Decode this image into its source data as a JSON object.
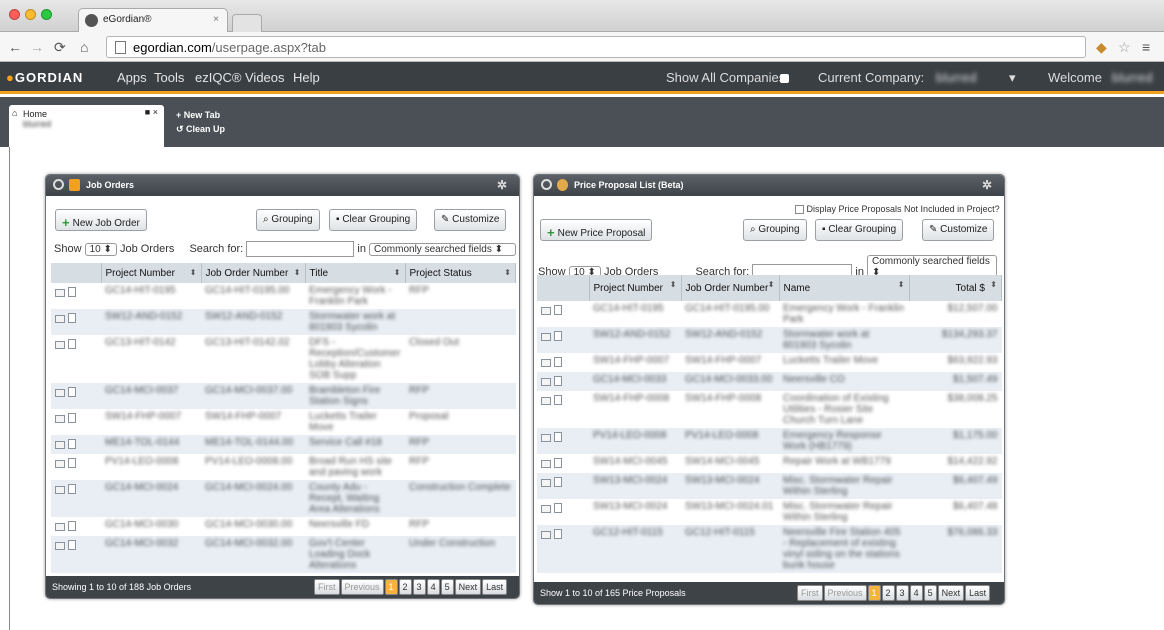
{
  "browser": {
    "tab_title": "eGordian®",
    "url_domain": "egordian.com",
    "url_path": "/userpage.aspx?tab"
  },
  "app": {
    "logo": "GORDIAN",
    "menu": [
      "Apps",
      "Tools",
      "ezIQC®",
      "Videos",
      "Help"
    ],
    "show_all_companies": "Show All Companies",
    "current_company_label": "Current Company:",
    "current_company_value": "blurred",
    "welcome": "Welcome",
    "welcome_user": "blurred"
  },
  "workspace": {
    "home_tab": "Home",
    "home_sub": "blurred",
    "new_tab": "New Tab",
    "clean_up": "Clean Up"
  },
  "job_orders": {
    "title": "Job Orders",
    "new_button": "New Job Order",
    "grouping": "Grouping",
    "clear_grouping": "Clear Grouping",
    "customize": "Customize",
    "show_label": "Show",
    "show_value": "10",
    "show_suffix": "Job Orders",
    "search_label": "Search for:",
    "in_label": "in",
    "search_scope": "Commonly searched fields",
    "columns": [
      "Project Number",
      "Job Order Number",
      "Title",
      "Project Status"
    ],
    "rows": [
      [
        "GC14-HIT-0195",
        "GC14-HIT-0195.00",
        "Emergency Work - Franklin Park",
        "RFP"
      ],
      [
        "SW12-AND-0152",
        "SW12-AND-0152",
        "Stormwater work at 801903 Sycolin",
        ""
      ],
      [
        "GC13-HIT-0142",
        "GC13-HIT-0142.02",
        "DFS - Reception/Customer Lobby Alteration SOB Supp",
        "Closed Out"
      ],
      [
        "GC14-MCI-0037",
        "GC14-MCI-0037.00",
        "Brambleton Fire Station Signs",
        "RFP"
      ],
      [
        "SW14-FHP-0007",
        "SW14-FHP-0007",
        "Lucketts Trailer Move",
        "Proposal"
      ],
      [
        "ME14-TOL-0144",
        "ME14-TOL-0144.00",
        "Service Call #18",
        "RFP"
      ],
      [
        "PV14-LEO-0008",
        "PV14-LEO-0008.00",
        "Broad Run HS site and paving work",
        "RFP"
      ],
      [
        "GC14-MCI-0024",
        "GC14-MCI-0024.00",
        "County Adu - Recept, Waiting Area Alterations",
        "Construction Complete"
      ],
      [
        "GC14-MCI-0030",
        "GC14-MCI-0030.00",
        "Neersville FD",
        "RFP"
      ],
      [
        "GC14-MCI-0032",
        "GC14-MCI-0032.00",
        "Gov't Center Loading Dock Alterations",
        "Under Construction"
      ]
    ],
    "footer": "Showing 1 to 10 of 188 Job Orders",
    "pager": [
      "First",
      "Previous",
      "1",
      "2",
      "3",
      "4",
      "5",
      "Next",
      "Last"
    ]
  },
  "price_proposals": {
    "title": "Price Proposal List (Beta)",
    "display_checkbox": "Display Price Proposals Not Included in Project?",
    "new_button": "New Price Proposal",
    "grouping": "Grouping",
    "clear_grouping": "Clear Grouping",
    "customize": "Customize",
    "show_label": "Show",
    "show_value": "10",
    "show_suffix": "Job Orders",
    "search_label": "Search for:",
    "in_label": "in",
    "search_scope": "Commonly searched fields",
    "columns": [
      "Project Number",
      "Job Order Number",
      "Name",
      "Total $"
    ],
    "rows": [
      [
        "GC14-HIT-0195",
        "GC14-HIT-0195.00",
        "Emergency Work - Franklin Park",
        "$12,507.00"
      ],
      [
        "SW12-AND-0152",
        "SW12-AND-0152",
        "Stormwater work at 801903 Sycolin",
        "$134,293.37"
      ],
      [
        "SW14-FHP-0007",
        "SW14-FHP-0007",
        "Lucketts Trailer Move",
        "$63,922.93"
      ],
      [
        "GC14-MCI-0033",
        "GC14-MCI-0033.00",
        "Neersville CO",
        "$1,507.49"
      ],
      [
        "SW14-FHP-0008",
        "SW14-FHP-0008",
        "Coordination of Existing Utilities - Rosier Site Church Turn Lane",
        "$38,008.25"
      ],
      [
        "PV14-LEO-0008",
        "PV14-LEO-0008",
        "Emergency Response Work (HB1779)",
        "$1,175.00"
      ],
      [
        "SW14-MCI-0045",
        "SW14-MCI-0045",
        "Repair Work at WB1779",
        "$14,422.92"
      ],
      [
        "SW13-MCI-0024",
        "SW13-MCI-0024",
        "Misc. Stormwater Repair Within Sterling",
        "$6,407.49"
      ],
      [
        "SW13-MCI-0024",
        "SW13-MCI-0024.01",
        "Misc. Stormwater Repair Within Sterling",
        "$6,407.48"
      ],
      [
        "GC12-HIT-0115",
        "GC12-HIT-0115",
        "Neersville Fire Station 405 - Replacement of existing vinyl siding on the stations bunk house",
        "$76,086.33"
      ]
    ],
    "footer": "Show 1 to 10 of 165 Price Proposals",
    "pager": [
      "First",
      "Previous",
      "1",
      "2",
      "3",
      "4",
      "5",
      "Next",
      "Last"
    ]
  }
}
